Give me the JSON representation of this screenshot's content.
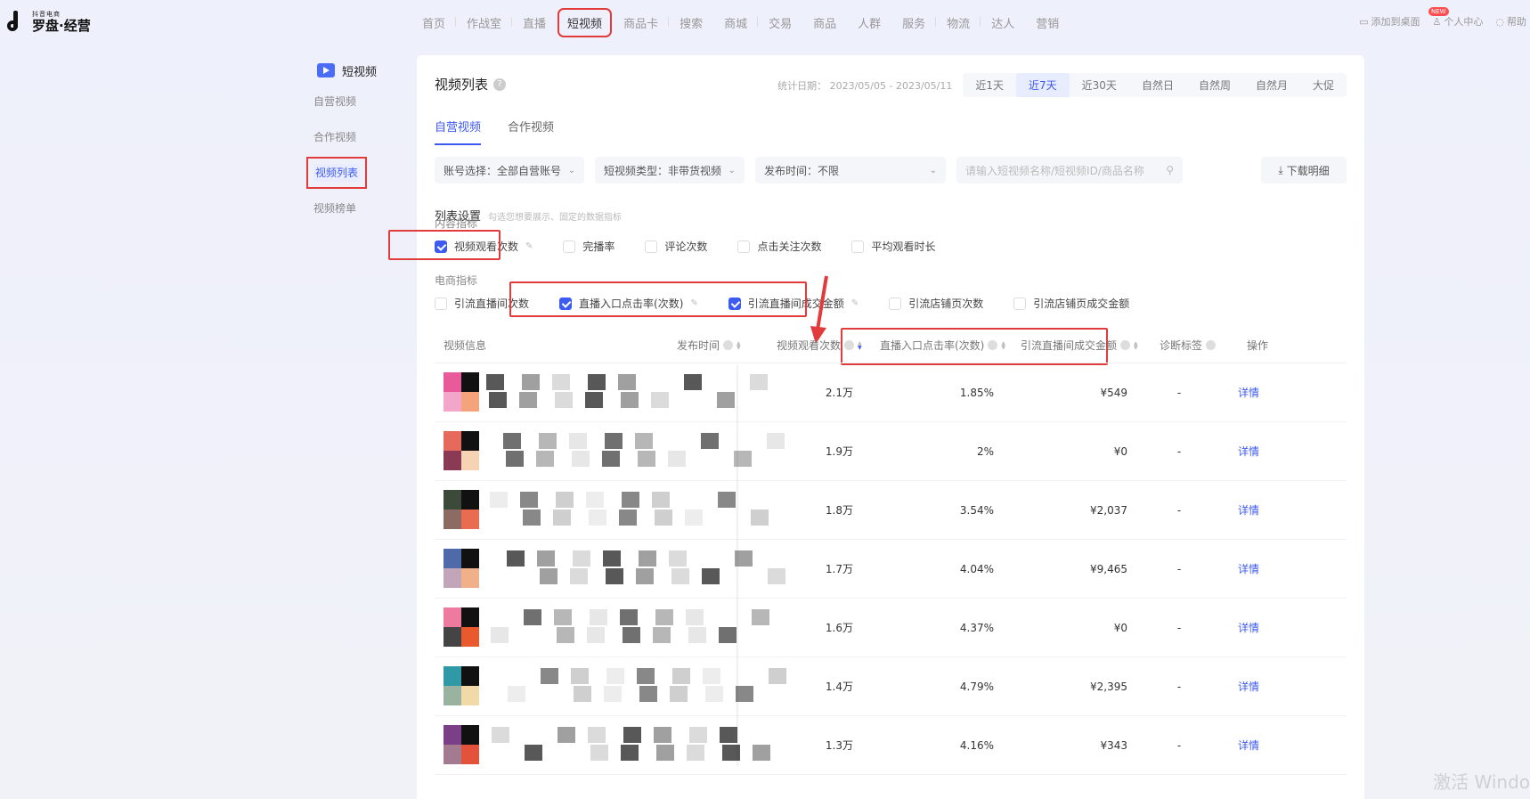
{
  "brand": {
    "sub": "抖音电商",
    "name": "罗盘·经营"
  },
  "nav": [
    "首页",
    "作战室",
    "直播",
    "短视频",
    "商品卡",
    "搜索",
    "商城",
    "交易",
    "商品",
    "人群",
    "服务",
    "物流",
    "达人",
    "营销"
  ],
  "nav_active": "短视频",
  "top_right": {
    "desktop": "添加到桌面",
    "new_badge": "NEW",
    "profile": "个人中心",
    "help": "帮助"
  },
  "sidebar": {
    "header": "短视频",
    "items": [
      "自营视频",
      "合作视频",
      "视频列表",
      "视频榜单"
    ],
    "active": "视频列表"
  },
  "panel": {
    "title": "视频列表",
    "date_label": "统计日期",
    "date_range": "2023/05/05 - 2023/05/11",
    "ranges": [
      "近1天",
      "近7天",
      "近30天",
      "自然日",
      "自然周",
      "自然月",
      "大促"
    ],
    "range_active": "近7天",
    "tabs": [
      "自营视频",
      "合作视频"
    ],
    "tab_active": "自营视频",
    "filters": {
      "account": "账号选择：全部自营账号",
      "type": "短视频类型：非带货视频",
      "publish": "发布时间：不限",
      "search_placeholder": "请输入短视频名称/短视频ID/商品名称",
      "download": "下载明细"
    },
    "settings_title": "列表设置",
    "settings_hint": "勾选您想要展示、固定的数据指标",
    "content_group": "内容指标",
    "content_checks": [
      {
        "label": "视频观看次数",
        "checked": true
      },
      {
        "label": "完播率",
        "checked": false
      },
      {
        "label": "评论次数",
        "checked": false
      },
      {
        "label": "点击关注次数",
        "checked": false
      },
      {
        "label": "平均观看时长",
        "checked": false
      }
    ],
    "ecom_group": "电商指标",
    "ecom_checks": [
      {
        "label": "引流直播间次数",
        "checked": false
      },
      {
        "label": "直播入口点击率(次数)",
        "checked": true
      },
      {
        "label": "引流直播间成交金额",
        "checked": true
      },
      {
        "label": "引流店铺页次数",
        "checked": false
      },
      {
        "label": "引流店铺页成交金额",
        "checked": false
      }
    ],
    "columns": [
      "视频信息",
      "发布时间",
      "视频观看次数",
      "直播入口点击率(次数)",
      "引流直播间成交金额",
      "诊断标签",
      "操作"
    ],
    "rows": [
      {
        "views": "2.1万",
        "ctr": "1.85%",
        "gmv": "¥549",
        "tag": "-",
        "action": "详情"
      },
      {
        "views": "1.9万",
        "ctr": "2%",
        "gmv": "¥0",
        "tag": "-",
        "action": "详情"
      },
      {
        "views": "1.8万",
        "ctr": "3.54%",
        "gmv": "¥2,037",
        "tag": "-",
        "action": "详情"
      },
      {
        "views": "1.7万",
        "ctr": "4.04%",
        "gmv": "¥9,465",
        "tag": "-",
        "action": "详情"
      },
      {
        "views": "1.6万",
        "ctr": "4.37%",
        "gmv": "¥0",
        "tag": "-",
        "action": "详情"
      },
      {
        "views": "1.4万",
        "ctr": "4.79%",
        "gmv": "¥2,395",
        "tag": "-",
        "action": "详情"
      },
      {
        "views": "1.3万",
        "ctr": "4.16%",
        "gmv": "¥343",
        "tag": "-",
        "action": "详情"
      }
    ]
  },
  "watermark": "激活 Windo",
  "colors": {
    "accent": "#3d5af1",
    "highlight": "#e23b3b"
  }
}
